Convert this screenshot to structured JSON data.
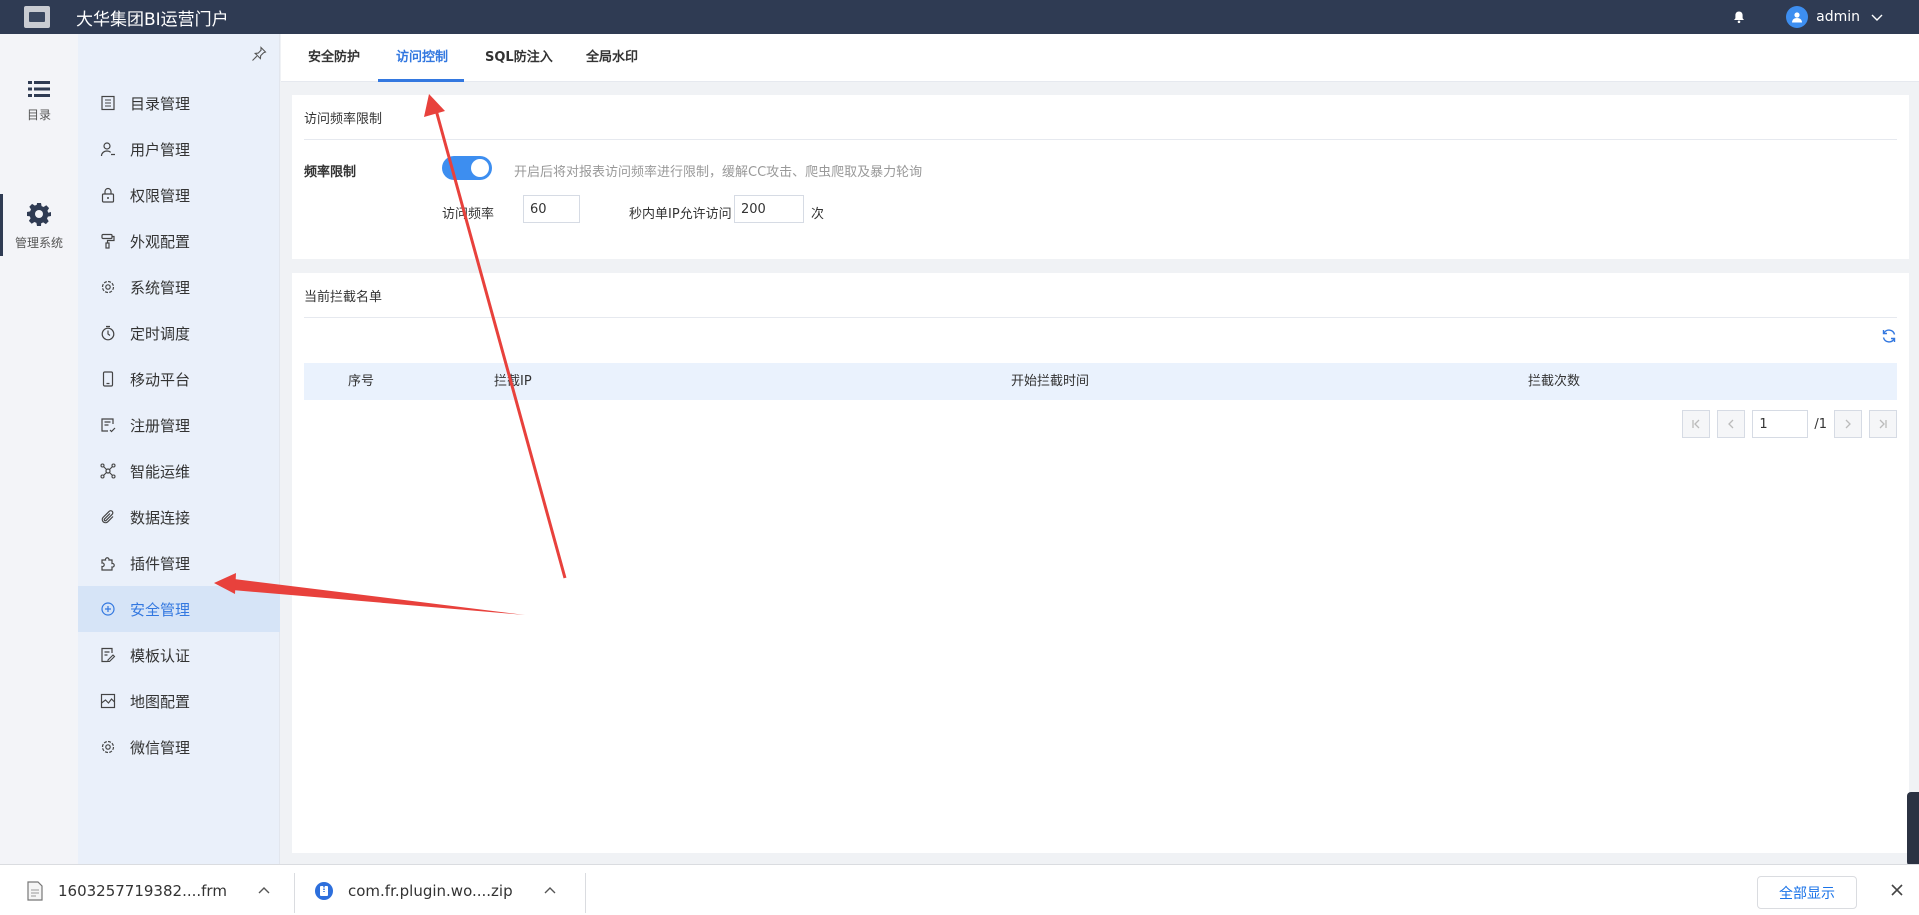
{
  "app": {
    "title": "大华集团BI运营门户"
  },
  "header": {
    "username": "admin"
  },
  "rail": {
    "items": [
      {
        "label": "目录",
        "icon": "list-icon"
      },
      {
        "label": "管理系统",
        "icon": "gear-icon"
      }
    ]
  },
  "menu": {
    "items": [
      {
        "label": "目录管理"
      },
      {
        "label": "用户管理"
      },
      {
        "label": "权限管理"
      },
      {
        "label": "外观配置"
      },
      {
        "label": "系统管理"
      },
      {
        "label": "定时调度"
      },
      {
        "label": "移动平台"
      },
      {
        "label": "注册管理"
      },
      {
        "label": "智能运维"
      },
      {
        "label": "数据连接"
      },
      {
        "label": "插件管理"
      },
      {
        "label": "安全管理"
      },
      {
        "label": "模板认证"
      },
      {
        "label": "地图配置"
      },
      {
        "label": "微信管理"
      }
    ],
    "active": "安全管理"
  },
  "tabs": [
    {
      "label": "安全防护"
    },
    {
      "label": "访问控制"
    },
    {
      "label": "SQL防注入"
    },
    {
      "label": "全局水印"
    }
  ],
  "active_tab": "访问控制",
  "rate_limit": {
    "section_title": "访问频率限制",
    "field_label": "频率限制",
    "enabled": true,
    "hint": "开启后将对报表访问频率进行限制，缓解CC攻击、爬虫爬取及暴力轮询",
    "rate_label": "访问频率",
    "seconds": "60",
    "mid_text": "秒内单IP允许访问",
    "max_visits": "200",
    "unit": "次"
  },
  "blocklist": {
    "title": "当前拦截名单",
    "columns": [
      "序号",
      "拦截IP",
      "开始拦截时间",
      "拦截次数"
    ],
    "rows": [],
    "pager": {
      "current": "1",
      "total": "/1"
    }
  },
  "downloads": {
    "items": [
      {
        "name": "1603257719382....frm"
      },
      {
        "name": "com.fr.plugin.wo....zip"
      }
    ],
    "show_all": "全部显示"
  },
  "colors": {
    "header_bg": "#2f3b53",
    "accent": "#3378e0",
    "annotation_arrow": "#e8413c"
  }
}
